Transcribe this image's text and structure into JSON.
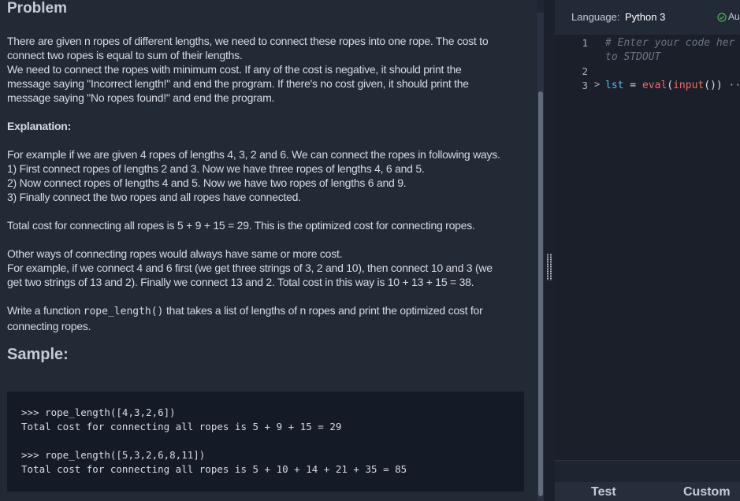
{
  "problem": {
    "title": "Problem",
    "intro_lines": [
      "There are given n ropes of different lengths, we need to connect these ropes into one rope. The cost to",
      "connect two ropes is equal to sum of their lengths.",
      "We need to connect the ropes with minimum cost. If any of the cost is negative, it should print the",
      "message saying \"Incorrect length!\" and end the program. If there's no cost given, it should print the",
      "message saying \"No ropes found!\" and end the program."
    ],
    "explanation_heading": "Explanation:",
    "example_lines": [
      "For example if we are given 4 ropes of lengths 4, 3, 2 and 6. We can connect the ropes in following ways.",
      "1) First connect ropes of lengths 2 and 3. Now we have three ropes of lengths 4, 6 and 5.",
      "2) Now connect ropes of lengths 4 and 5. Now we have two ropes of lengths 6 and 9.",
      "3) Finally connect the two ropes and all ropes have connected."
    ],
    "total_cost_line": "Total cost for connecting all ropes is 5 + 9 + 15 = 29. This is the optimized cost for connecting ropes.",
    "other_ways_lines": [
      "Other ways of connecting ropes would always have same or more cost.",
      "For example, if we connect 4 and 6 first (we get three strings of 3, 2 and 10), then connect 10 and 3 (we",
      "get two strings of 13 and 2). Finally we connect 13 and 2. Total cost in this way is 10 + 13 + 15 = 38."
    ],
    "write_prefix": "Write a function ",
    "write_code": "rope_length()",
    "write_suffix": " that takes a list of lengths of n ropes and print the optimized cost for",
    "write_line2": "connecting ropes.",
    "sample_heading": "Sample:",
    "sample_lines": [
      ">>> rope_length([4,3,2,6])",
      "Total cost for connecting all ropes is 5 + 9 + 15 = 29",
      ">>> rope_length([5,3,2,6,8,11])",
      "Total cost for connecting all ropes is 5 + 10 + 14 + 21 + 35 = 85"
    ]
  },
  "editor": {
    "language_label": "Language:",
    "language_value": "Python 3",
    "autosave_label": "Au",
    "line_numbers": [
      "1",
      "2",
      "3"
    ],
    "comment_line1": "# Enter your code her",
    "comment_line2": "to STDOUT",
    "code_var": "lst",
    "code_eq": " = ",
    "code_func1": "eval",
    "code_paren_open": "(",
    "code_func2": "input",
    "code_rest": "())",
    "code_fold": " ···",
    "fold_arrow": ">"
  },
  "tabs": {
    "test": "Test",
    "custom": "Custom"
  },
  "colors": {
    "background": "#222a36",
    "editor_background": "#1a1f29",
    "text": "#d7dbe2",
    "accent_variable": "#5bb8e8",
    "accent_function": "#ef6b6b",
    "autosave_check": "#3fb950"
  }
}
